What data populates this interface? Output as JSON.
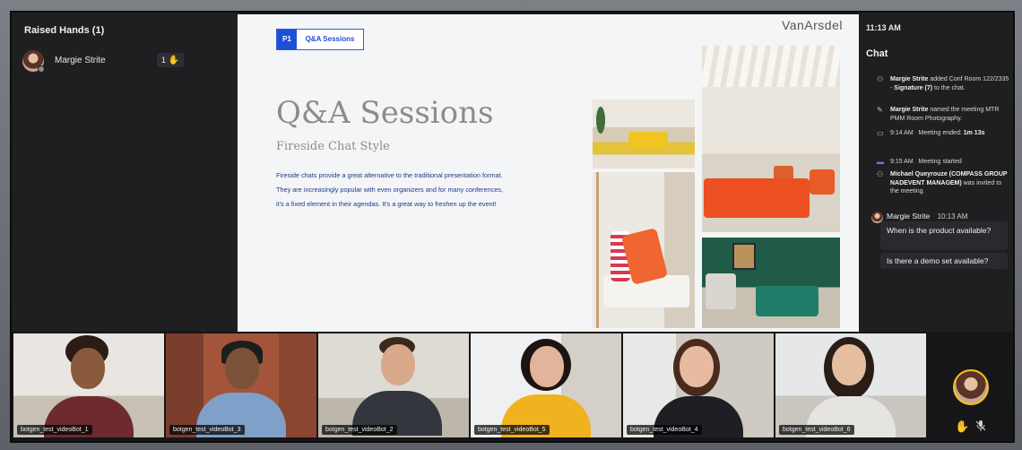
{
  "raised_hands": {
    "title": "Raised Hands (1)",
    "items": [
      {
        "name": "Margie Strite",
        "order": "1",
        "hand_icon": "raised-hand-icon"
      }
    ]
  },
  "slide": {
    "tab_number": "P1",
    "tab_label": "Q&A Sessions",
    "brand": "VanArsdel",
    "title": "Q&A Sessions",
    "subtitle": "Fireside Chat Style",
    "body_lines": [
      "Fireside chats provide a great alternative to the traditional presentation format.",
      "They are increasingly popular with even organizers and for many conferences,",
      "it's a fixed element in their agendas. It's a great way to freshen up the event!"
    ]
  },
  "chat": {
    "time": "11:13 AM",
    "title": "Chat",
    "events": [
      {
        "icon": "person-add-icon",
        "html": "<b>Margie Strite</b> added Conf Room 122/2335 - <b>Signature (7)</b> to the chat."
      },
      {
        "icon": "pencil-icon",
        "html": "<b>Margie Strite</b> named the meeting MTR PMM Room Photography."
      },
      {
        "icon": "camera-icon",
        "html": "9:14 AM&nbsp;&nbsp; Meeting ended: <b>1m 13s</b>"
      },
      {
        "icon": "camera-icon",
        "html": "9:15 AM&nbsp;&nbsp; Meeting started"
      },
      {
        "icon": "person-add-icon",
        "html": "<b>Michael Queyrouze (COMPASS GROUP NADEVENT MANAGEM)</b> was invited to the meeting."
      }
    ],
    "message": {
      "sender": "Margie Strite",
      "time": "10:13 AM",
      "lines": [
        "When is the product available?",
        "Is there a demo set available?"
      ]
    }
  },
  "participants": [
    {
      "label": "botgen_test_videoBot_1"
    },
    {
      "label": "botgen_test_videoBot_3"
    },
    {
      "label": "botgen_test_videoBot_2"
    },
    {
      "label": "botgen_test_videoBot_5"
    },
    {
      "label": "botgen_test_videoBot_4"
    },
    {
      "label": "botgen_test_videoBot_6"
    }
  ],
  "colors": {
    "accent": "#1f4fd6",
    "raised_hand": "#f6c21a",
    "panel": "#1f1f22",
    "slide_bg": "#f4f5f7"
  }
}
